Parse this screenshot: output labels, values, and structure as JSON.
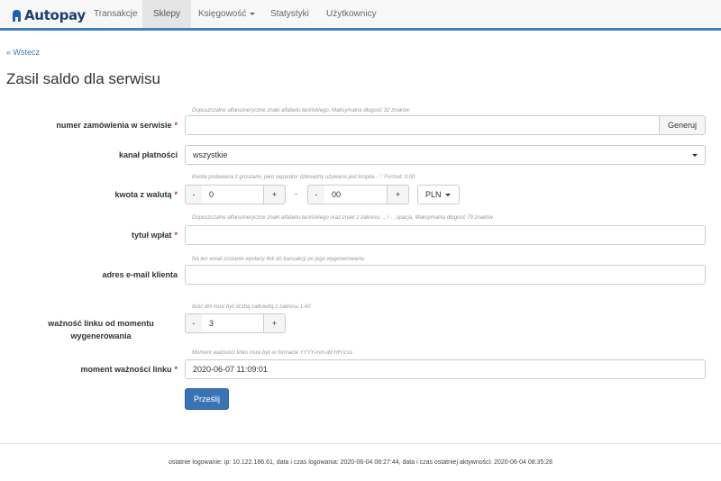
{
  "brand": {
    "name": "Autopay",
    "color": "#1f3f73",
    "accent": "#3f7fc4"
  },
  "nav": {
    "items": [
      {
        "label": "Transakcje"
      },
      {
        "label": "Sklepy"
      },
      {
        "label": "Księgowość"
      },
      {
        "label": "Statystyki"
      },
      {
        "label": "Użytkownicy"
      }
    ],
    "active": "Sklepy"
  },
  "back_link": "« Wstecz",
  "page_title": "Zasil saldo dla serwisu",
  "form": {
    "order_number": {
      "label": "numer zamówienia w serwisie",
      "required": "*",
      "hint": "Dopuszczalne alfanumeryczne znaki alfabetu łacińskiego, Maksymalna długość 32 znaków",
      "value": "",
      "generate_label": "Generuj"
    },
    "payment_channel": {
      "label": "kanał płatności",
      "selected": "wszystkie"
    },
    "amount": {
      "label": "kwota z walutą",
      "required": "*",
      "hint": "Kwota podawana z groszami, jako separator dziesiętny używana jest kropka - '.' Format: 0.00",
      "main_value": "0",
      "fraction_value": "00",
      "separator": "-",
      "minus": "-",
      "plus": "+",
      "currency": "PLN"
    },
    "title": {
      "label": "tytuł wpłat",
      "required": "*",
      "hint": "Dopuszczalne alfanumeryczne znaki alfabetu łacińskiego oraz znaki z zakresu: ., / - , spacja, Maksymalna długość 79 znaków",
      "value": ""
    },
    "email": {
      "label": "adres e-mail klienta",
      "hint": "Na ten email zostanie wysłany link do transakcji po jego wygenerowaniu",
      "value": ""
    },
    "link_validity": {
      "label_line1": "ważność linku od momentu",
      "label_line2": "wygenerowania",
      "hint": "Ilość dni musi być liczbą całkowitą z zakresu 1-60",
      "value": "3",
      "minus": "-",
      "plus": "+"
    },
    "expiry": {
      "label": "moment ważności linku",
      "required": "*",
      "hint": "Moment ważności linku musi być w formacie YYYY-mm-dd HH:ii:ss",
      "value": "2020-06-07 11:09:01"
    },
    "submit_label": "Prześlij"
  },
  "footer": "ostatnie logowanie: ip: 10.122.186.61, data i czas logowania: 2020-06-04 08:27:44, data i czas ostatniej aktywności: 2020-06-04 08:35:28"
}
